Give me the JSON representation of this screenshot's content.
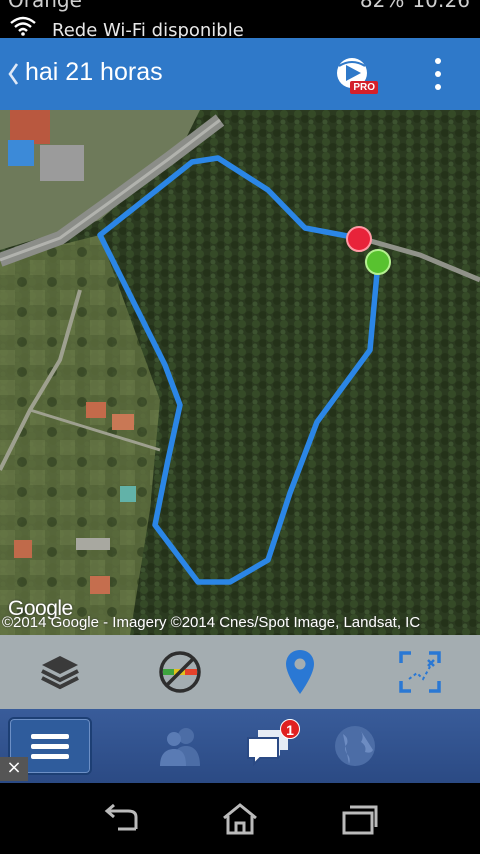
{
  "status_bar": {
    "carrier": "Orange",
    "notification": "Rede Wi-Fi disponible",
    "battery": "82%",
    "time": "10:26"
  },
  "app_bar": {
    "title": "hai 21 horas",
    "back_icon": "chevron-left-icon",
    "pro_badge": "PRO",
    "more_icon": "overflow-menu-icon"
  },
  "map": {
    "watermark": "Google",
    "attribution": "©2014 Google - Imagery ©2014 Cnes/Spot Image, Landsat, IC",
    "route_color": "#2b86e6",
    "start_marker_color": "#58c22f",
    "end_marker_color": "#e8233a"
  },
  "map_tools": [
    {
      "icon": "layers-icon"
    },
    {
      "icon": "speed-colors-icon"
    },
    {
      "icon": "location-pin-icon"
    },
    {
      "icon": "fit-route-icon"
    }
  ],
  "bottom_nav": {
    "menu_icon": "hamburger-menu-icon",
    "friends_icon": "friends-icon",
    "messages_icon": "messages-icon",
    "messages_badge": "1",
    "globe_icon": "globe-icon",
    "close_label": "×"
  },
  "system_nav": [
    "back-icon",
    "home-icon",
    "recents-icon"
  ]
}
